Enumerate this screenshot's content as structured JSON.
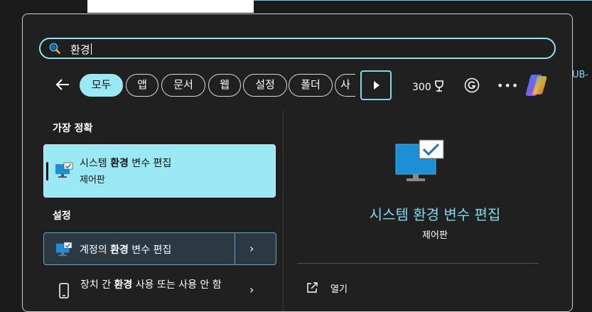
{
  "background": {
    "edge_text": "UB-"
  },
  "search": {
    "value": "환경"
  },
  "filters": {
    "chips": [
      {
        "label": "모두",
        "active": true
      },
      {
        "label": "앱"
      },
      {
        "label": "문서"
      },
      {
        "label": "웹"
      },
      {
        "label": "설정"
      },
      {
        "label": "폴더"
      },
      {
        "label": "사"
      }
    ]
  },
  "toolbar": {
    "points": "300"
  },
  "results": {
    "best_match_heading": "가장 정확",
    "best_match": {
      "title_before": "시스템 ",
      "title_bold": "환경",
      "title_after": " 변수 편집",
      "subtitle": "제어판"
    },
    "settings_heading": "설정",
    "settings": [
      {
        "before": "계정의 ",
        "bold": "환경",
        "after": " 변수 편집"
      },
      {
        "before": "장치 간 ",
        "bold": "환경",
        "after": " 사용 또는 사용 안 함"
      }
    ]
  },
  "detail": {
    "title": "시스템 환경 변수 편집",
    "subtitle": "제어판",
    "actions": [
      {
        "label": "열기"
      }
    ]
  },
  "colors": {
    "accent": "#9be8f5",
    "panel": "#202020",
    "highlight_text": "#7fd9ea"
  },
  "icons": [
    "search-icon",
    "back-arrow-icon",
    "play-icon",
    "trophy-icon",
    "g-icon",
    "more-icon",
    "copilot-icon",
    "monitor-check-icon",
    "phone-icon",
    "chevron-right-icon",
    "open-external-icon"
  ]
}
